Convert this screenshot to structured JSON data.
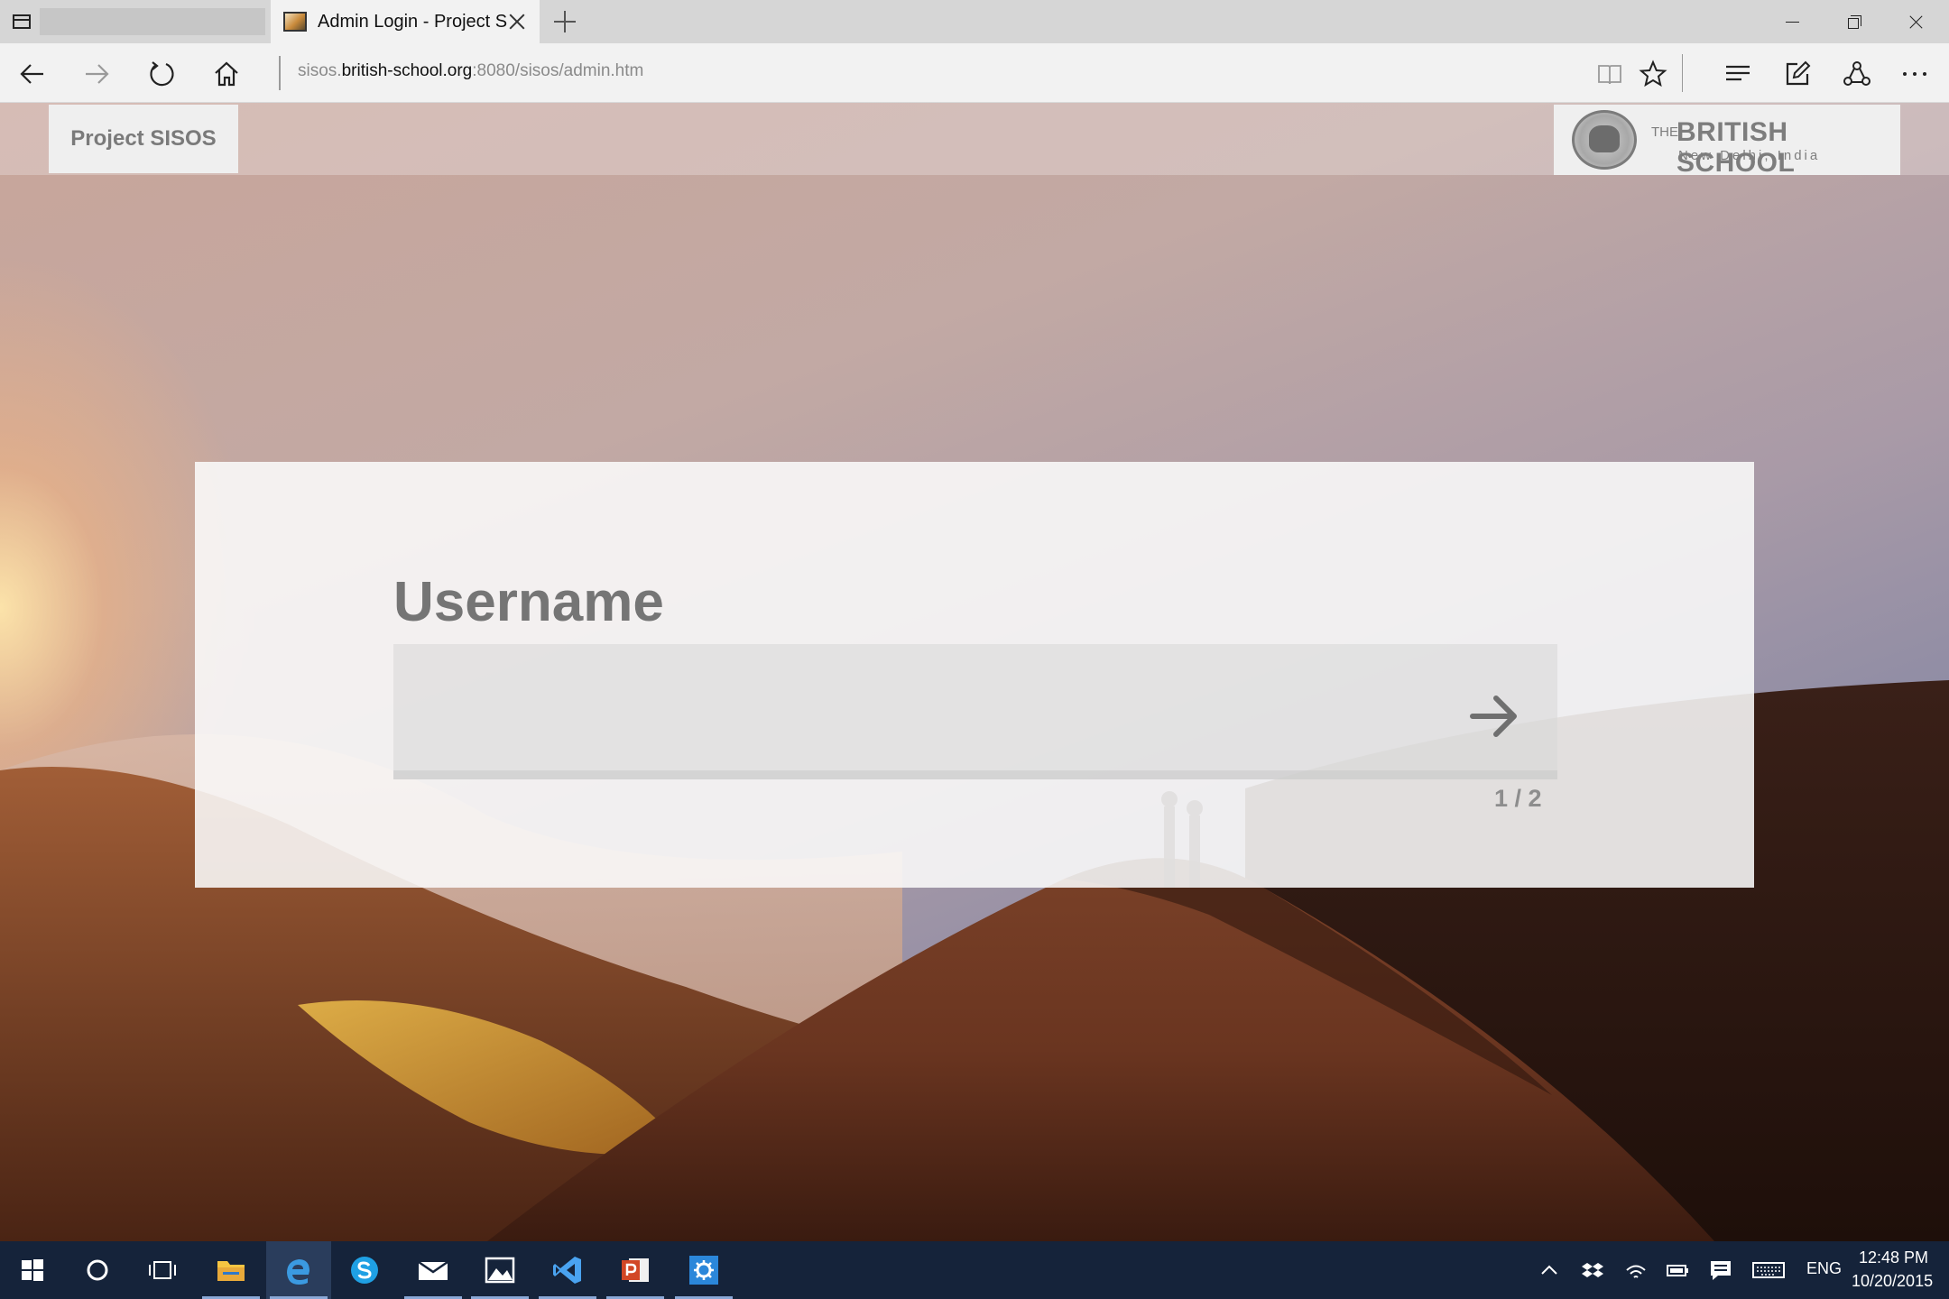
{
  "browser": {
    "active_tab_title": "Admin Login - Project S",
    "url_prefix": "sisos.",
    "url_domain": "british-school.org",
    "url_suffix": ":8080/sisos/admin.htm"
  },
  "page": {
    "brand": "Project SISOS",
    "school": {
      "the": "THE",
      "name": "BRITISH SCHOOL",
      "city": "New Delhi, India"
    },
    "form": {
      "label": "Username",
      "value": "",
      "step": "1 / 2"
    }
  },
  "taskbar": {
    "apps": [
      "start-button",
      "search",
      "task-view",
      "file-explorer",
      "edge",
      "skype",
      "mail",
      "photos",
      "visual-studio",
      "powerpoint",
      "settings"
    ],
    "language": "ENG",
    "time": "12:48 PM",
    "date": "10/20/2015"
  },
  "colors": {
    "taskbar": "#15233a",
    "card": "#fafafa",
    "label_gray": "#757575"
  }
}
